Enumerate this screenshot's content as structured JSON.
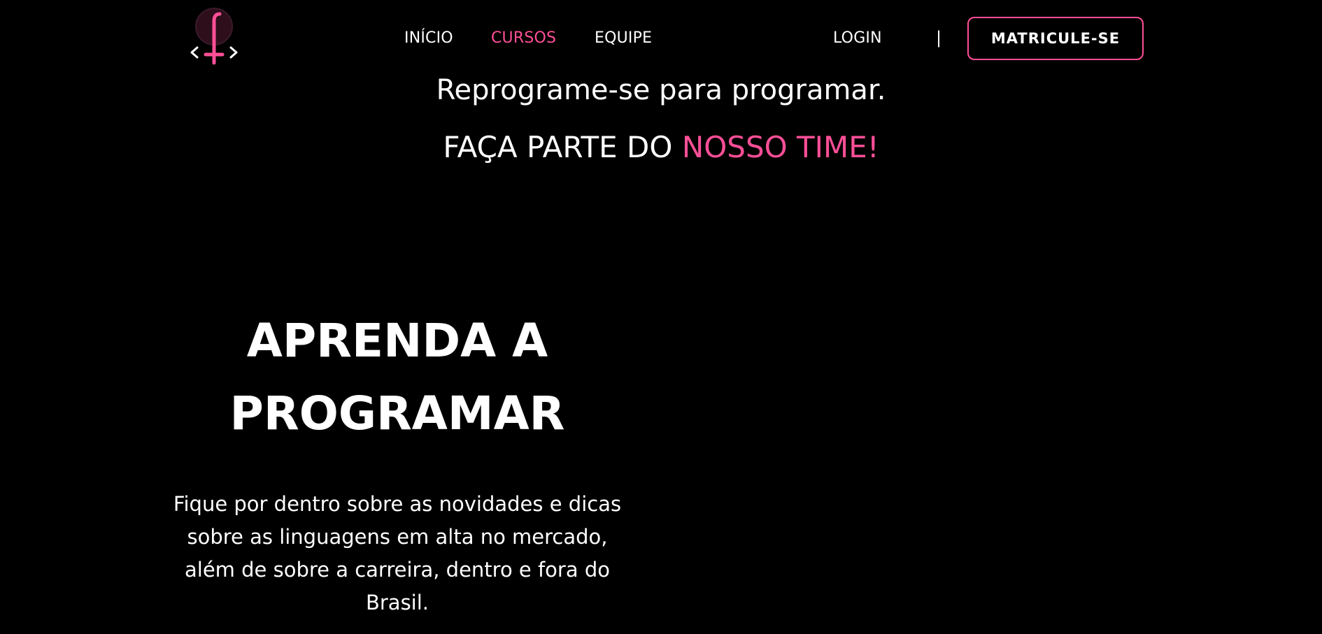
{
  "colors": {
    "background": "#000000",
    "text": "#ffffff",
    "accent": "#ff4f97"
  },
  "header": {
    "logo_icon": "code-brackets-logo-icon",
    "nav": [
      {
        "label": "INÍCIO",
        "active": false
      },
      {
        "label": "CURSOS",
        "active": true
      },
      {
        "label": "EQUIPE",
        "active": false
      }
    ],
    "login_label": "LOGIN",
    "divider": "|",
    "enroll_label": "MATRICULE-SE"
  },
  "hero": {
    "tagline": "Reprograme-se para programar.",
    "subtagline_prefix": "FAÇA PARTE DO ",
    "subtagline_accent": "NOSSO TIME!",
    "title_line1": "APRENDA A",
    "title_line2": "PROGRAMAR",
    "description": "Fique por dentro sobre as novidades e dicas sobre as linguagens em alta no mercado, além de sobre a carreira, dentro e fora do Brasil."
  }
}
